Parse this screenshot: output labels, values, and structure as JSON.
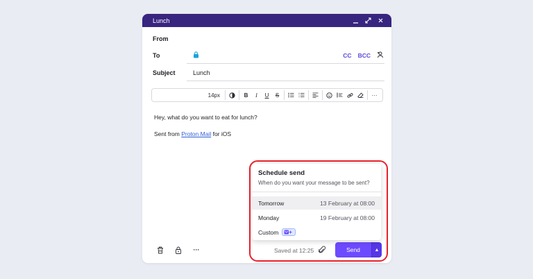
{
  "window": {
    "title": "Lunch",
    "controls": [
      "minimize",
      "expand",
      "close"
    ]
  },
  "fields": {
    "from_label": "From",
    "to_label": "To",
    "cc_label": "CC",
    "bcc_label": "BCC",
    "subject_label": "Subject",
    "subject_value": "Lunch"
  },
  "toolbar": {
    "font_size": "14px"
  },
  "message": {
    "line1": "Hey, what do you want to eat for lunch?",
    "signature_prefix": "Sent from ",
    "signature_link": "Proton Mail",
    "signature_suffix": " for iOS"
  },
  "footer": {
    "saved_text": "Saved at 12:25",
    "send_label": "Send"
  },
  "schedule": {
    "title": "Schedule send",
    "subtitle": "When do you want your message to be sent?",
    "options": [
      {
        "label": "Tomorrow",
        "when": "13 February at 08:00"
      },
      {
        "label": "Monday",
        "when": "19 February at 08:00"
      },
      {
        "label": "Custom",
        "when": ""
      }
    ]
  },
  "colors": {
    "titlebar": "#372580",
    "accent": "#6d4aff",
    "link": "#2f5fd6",
    "highlight": "#e8202a"
  }
}
